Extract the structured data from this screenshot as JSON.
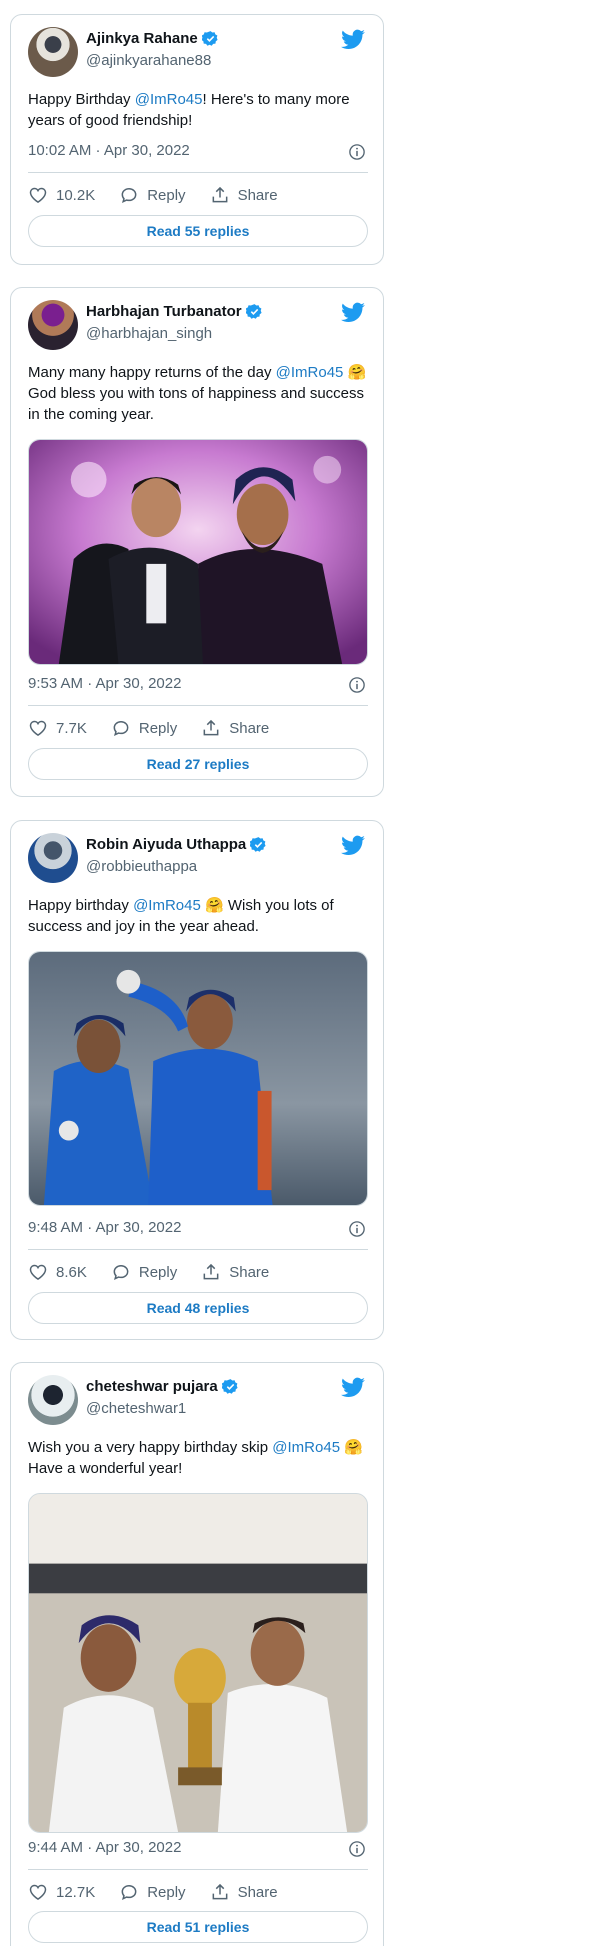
{
  "colors": {
    "accent": "#1d9bf0",
    "link": "#1d7bc4",
    "muted": "#536471",
    "border": "#cfd9de"
  },
  "icons": {
    "verified": "verified-badge-icon",
    "bird": "twitter-bird-icon",
    "info": "info-icon",
    "like": "heart-icon",
    "reply": "reply-bubble-icon",
    "share": "share-icon"
  },
  "labels": {
    "reply": "Reply",
    "share": "Share"
  },
  "tweets": [
    {
      "name": "Ajinkya Rahane",
      "handle": "@ajinkyarahane88",
      "text_pre": "Happy Birthday ",
      "mention": "@ImRo45",
      "text_post": "! Here's to many more years of good friendship!",
      "time": "10:02 AM · Apr 30, 2022",
      "likes": "10.2K",
      "read_replies": "Read 55 replies"
    },
    {
      "name": "Harbhajan Turbanator",
      "handle": "@harbhajan_singh",
      "text_pre": "Many many happy returns of the day ",
      "mention": "@ImRo45",
      "text_post": " 🤗 God bless you with tons of happiness and success in the coming year.",
      "time": "9:53 AM · Apr 30, 2022",
      "likes": "7.7K",
      "read_replies": "Read 27 replies"
    },
    {
      "name": "Robin Aiyuda Uthappa",
      "handle": "@robbieuthappa",
      "text_pre": "Happy birthday ",
      "mention": "@ImRo45",
      "text_post": " 🤗 Wish you lots of success and joy in the year ahead.",
      "time": "9:48 AM · Apr 30, 2022",
      "likes": "8.6K",
      "read_replies": "Read 48 replies"
    },
    {
      "name": "cheteshwar pujara",
      "handle": "@cheteshwar1",
      "text_pre": "Wish you a very happy birthday skip ",
      "mention": "@ImRo45",
      "text_post": " 🤗 Have a wonderful year!",
      "time": "9:44 AM · Apr 30, 2022",
      "likes": "12.7K",
      "read_replies": "Read 51 replies"
    }
  ]
}
